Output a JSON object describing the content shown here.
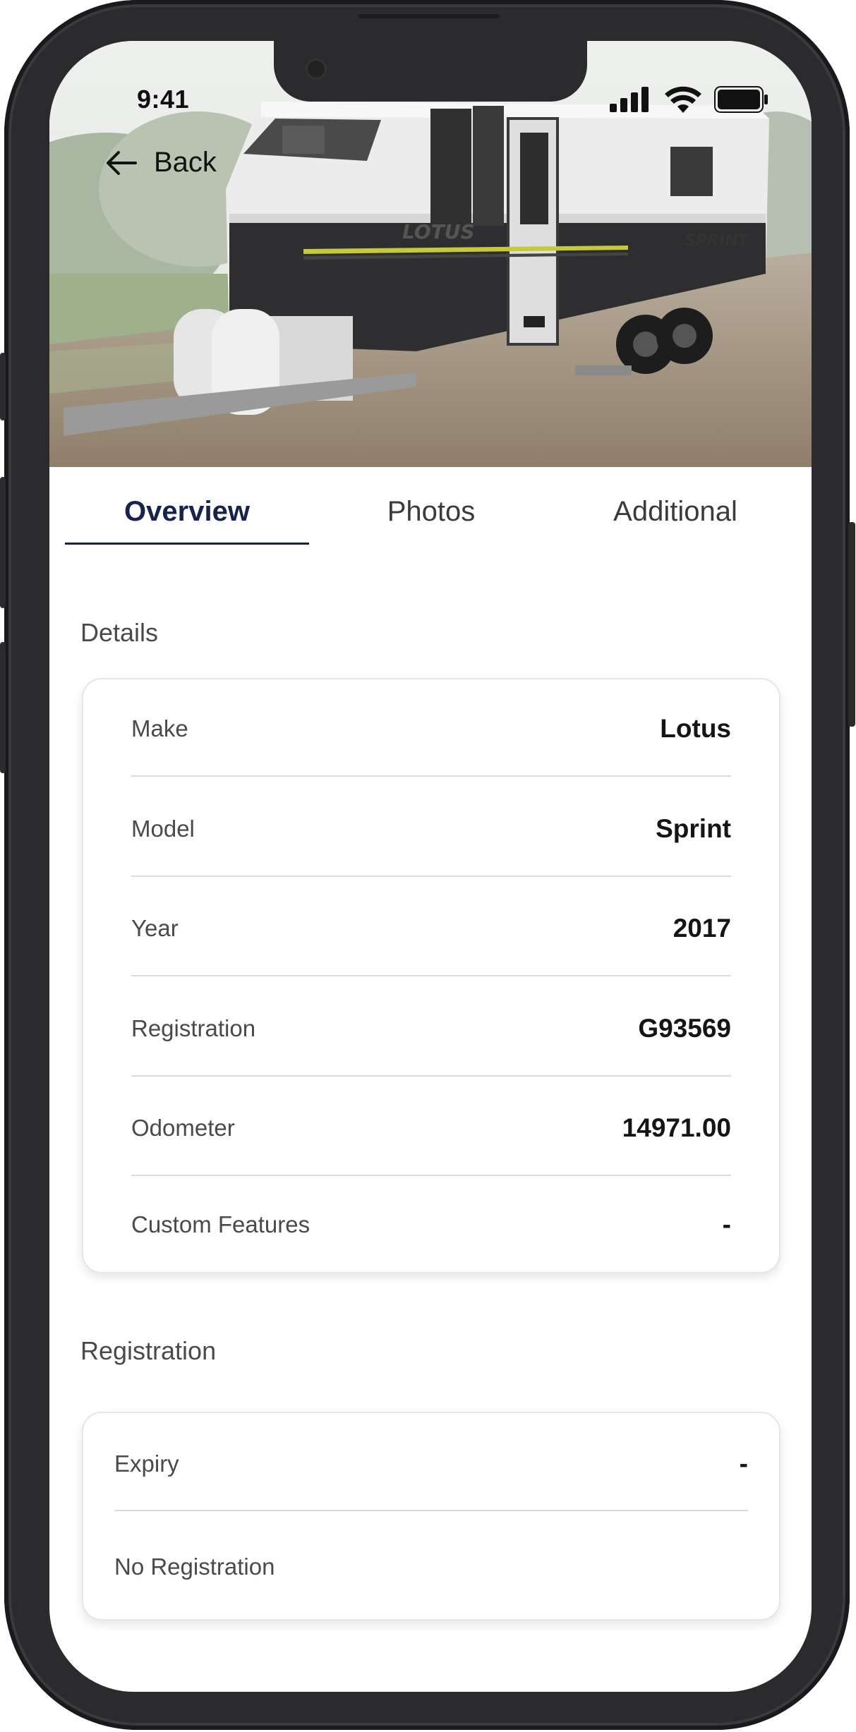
{
  "status_bar": {
    "time": "9:41"
  },
  "nav": {
    "back_label": "Back"
  },
  "tabs": [
    {
      "label": "Overview",
      "active": true
    },
    {
      "label": "Photos",
      "active": false
    },
    {
      "label": "Additional",
      "active": false
    }
  ],
  "details": {
    "title": "Details",
    "rows": [
      {
        "label": "Make",
        "value": "Lotus"
      },
      {
        "label": "Model",
        "value": "Sprint"
      },
      {
        "label": "Year",
        "value": "2017"
      },
      {
        "label": "Registration",
        "value": "G93569"
      },
      {
        "label": "Odometer",
        "value": "14971.00"
      },
      {
        "label": "Custom Features",
        "value": "-"
      }
    ]
  },
  "registration": {
    "title": "Registration",
    "expiry_label": "Expiry",
    "expiry_value": "-",
    "status_text": "No Registration"
  },
  "hero": {
    "caravan_brand": "LOTUS",
    "caravan_model": "SPRINT"
  },
  "colors": {
    "accent": "#16244d",
    "phone_frame": "#2b2b2d"
  }
}
